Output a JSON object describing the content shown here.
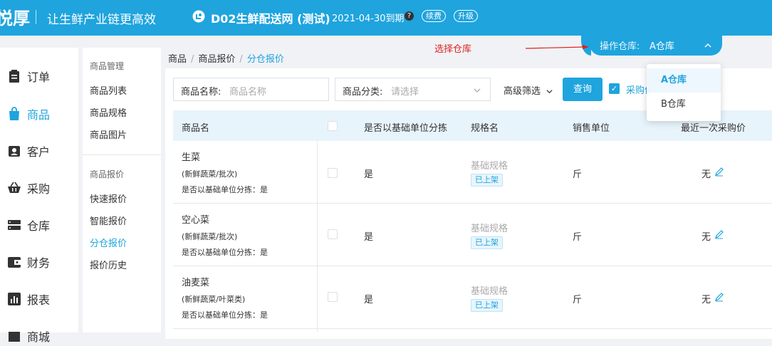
{
  "header": {
    "logo": "悦厚",
    "slogan": "让生鲜产业链更高效",
    "shop_name": "D02生鲜配送网 (测试)",
    "expire": "2021-04-30到期",
    "help": "?",
    "renew": "续费",
    "upgrade": "升级",
    "brand_color": "#1fa4de"
  },
  "warehouse": {
    "label": "操作仓库:",
    "value": "A仓库",
    "options": [
      "A仓库",
      "B仓库"
    ],
    "annotation": "选择仓库"
  },
  "sidebar": {
    "items": [
      {
        "label": "订单",
        "icon": "clipboard-icon"
      },
      {
        "label": "商品",
        "icon": "shopping-bag-icon"
      },
      {
        "label": "客户",
        "icon": "customer-icon"
      },
      {
        "label": "采购",
        "icon": "basket-icon"
      },
      {
        "label": "仓库",
        "icon": "warehouse-icon"
      },
      {
        "label": "财务",
        "icon": "wallet-icon"
      },
      {
        "label": "报表",
        "icon": "chart-icon"
      },
      {
        "label": "商城",
        "icon": "store-icon"
      }
    ]
  },
  "subnav": {
    "group1": "商品管理",
    "items1": [
      "商品列表",
      "商品规格",
      "商品图片"
    ],
    "group2": "商品报价",
    "items2": [
      "快速报价",
      "智能报价",
      "分仓报价",
      "报价历史"
    ]
  },
  "breadcrumb": [
    "商品",
    "商品报价",
    "分仓报价"
  ],
  "filters": {
    "name_label": "商品名称:",
    "name_placeholder": "商品名称",
    "category_label": "商品分类:",
    "category_placeholder": "请选择",
    "advanced": "高级筛选",
    "query_button": "查询",
    "checkbox_text": "采购价和公式自动"
  },
  "table": {
    "headers": [
      "商品名",
      "是否以基础单位分拣",
      "规格名",
      "销售单位",
      "最近一次采购价"
    ],
    "rows": [
      {
        "name": "生菜",
        "category": "(新鲜蔬菜/批次)",
        "split_note": "是否以基础单位分拣：是",
        "split": "是",
        "spec": "基础规格",
        "status": "已上架",
        "unit": "斤",
        "last_price": "无"
      },
      {
        "name": "空心菜",
        "category": "(新鲜蔬菜/批次)",
        "split_note": "是否以基础单位分拣：是",
        "split": "是",
        "spec": "基础规格",
        "status": "已上架",
        "unit": "斤",
        "last_price": "无"
      },
      {
        "name": "油麦菜",
        "category": "(新鲜蔬菜/叶菜类)",
        "split_note": "是否以基础单位分拣：是",
        "split": "是",
        "spec": "基础规格",
        "status": "已上架",
        "unit": "斤",
        "last_price": "无"
      }
    ]
  }
}
